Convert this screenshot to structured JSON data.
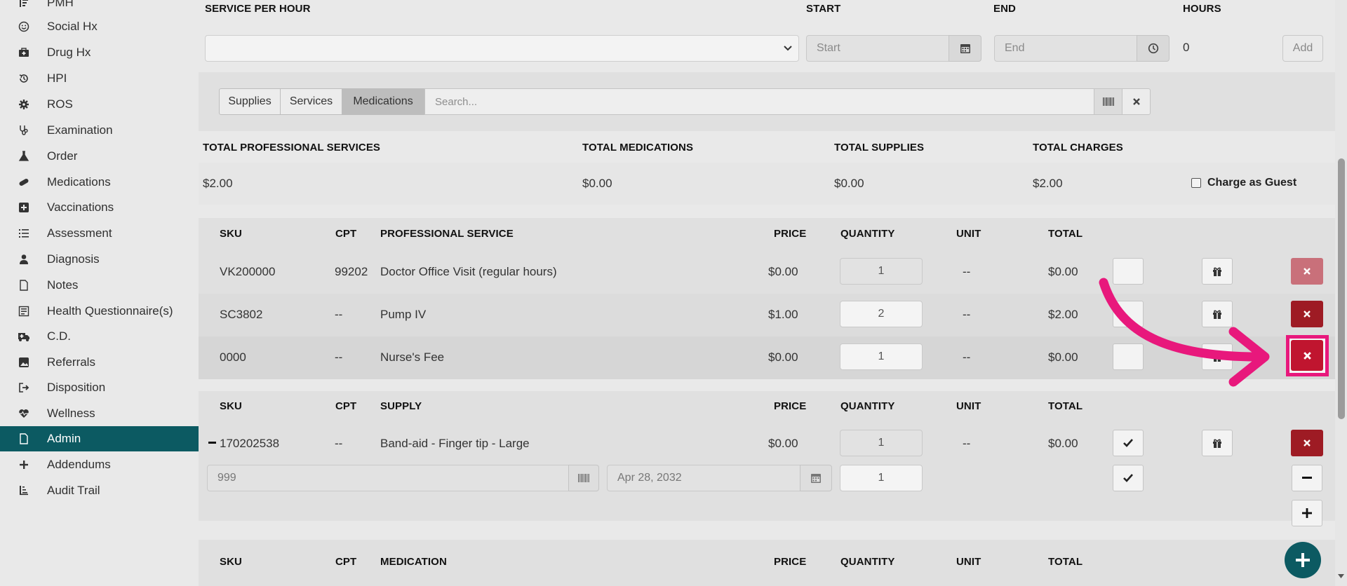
{
  "sidebar": {
    "items": [
      {
        "label": "PMH",
        "icon": "list-sort-icon"
      },
      {
        "label": "Social Hx",
        "icon": "smile-icon"
      },
      {
        "label": "Drug Hx",
        "icon": "medkit-icon"
      },
      {
        "label": "HPI",
        "icon": "history-icon"
      },
      {
        "label": "ROS",
        "icon": "gear-icon"
      },
      {
        "label": "Examination",
        "icon": "stethoscope-icon"
      },
      {
        "label": "Order",
        "icon": "flask-icon"
      },
      {
        "label": "Medications",
        "icon": "pill-icon"
      },
      {
        "label": "Vaccinations",
        "icon": "plus-square-icon"
      },
      {
        "label": "Assessment",
        "icon": "list-icon"
      },
      {
        "label": "Diagnosis",
        "icon": "user-doctor-icon"
      },
      {
        "label": "Notes",
        "icon": "file-icon"
      },
      {
        "label": "Health Questionnaire(s)",
        "icon": "form-icon"
      },
      {
        "label": "C.D.",
        "icon": "ambulance-icon"
      },
      {
        "label": "Referrals",
        "icon": "image-icon"
      },
      {
        "label": "Disposition",
        "icon": "sign-out-icon"
      },
      {
        "label": "Wellness",
        "icon": "heartbeat-icon"
      },
      {
        "label": "Admin",
        "icon": "file-icon"
      },
      {
        "label": "Addendums",
        "icon": "plus-icon"
      },
      {
        "label": "Audit Trail",
        "icon": "sort-amount-icon"
      }
    ],
    "active": "Admin"
  },
  "service_per_hour": {
    "headers": {
      "service": "SERVICE PER HOUR",
      "start": "START",
      "end": "END",
      "hours": "HOURS"
    },
    "start_placeholder": "Start",
    "end_placeholder": "End",
    "hours_value": "0",
    "add_label": "Add"
  },
  "search_tabs": {
    "tabs": [
      "Supplies",
      "Services",
      "Medications"
    ],
    "active": "Medications",
    "search_placeholder": "Search..."
  },
  "totals": {
    "headers": [
      "TOTAL PROFESSIONAL SERVICES",
      "TOTAL MEDICATIONS",
      "TOTAL SUPPLIES",
      "TOTAL CHARGES"
    ],
    "values": [
      "$2.00",
      "$0.00",
      "$0.00",
      "$2.00"
    ],
    "guest_label": "Charge as Guest"
  },
  "professional_services": {
    "headers": {
      "sku": "SKU",
      "cpt": "CPT",
      "name": "PROFESSIONAL SERVICE",
      "price": "PRICE",
      "quantity": "QUANTITY",
      "unit": "UNIT",
      "total": "TOTAL"
    },
    "rows": [
      {
        "sku": "VK200000",
        "cpt": "99202",
        "name": "Doctor Office Visit (regular hours)",
        "price": "$0.00",
        "quantity": "1",
        "unit": "--",
        "total": "$0.00"
      },
      {
        "sku": "SC3802",
        "cpt": "--",
        "name": "Pump IV",
        "price": "$1.00",
        "quantity": "2",
        "unit": "--",
        "total": "$2.00"
      },
      {
        "sku": "0000",
        "cpt": "--",
        "name": "Nurse's Fee",
        "price": "$0.00",
        "quantity": "1",
        "unit": "--",
        "total": "$0.00"
      }
    ]
  },
  "supplies": {
    "headers": {
      "sku": "SKU",
      "cpt": "CPT",
      "name": "SUPPLY",
      "price": "PRICE",
      "quantity": "QUANTITY",
      "unit": "UNIT",
      "total": "TOTAL"
    },
    "rows": [
      {
        "sku": "170202538",
        "cpt": "--",
        "name": "Band-aid - Finger tip - Large",
        "price": "$0.00",
        "quantity": "1",
        "unit": "--",
        "total": "$0.00"
      }
    ],
    "lot_value": "999",
    "expiry_value": "Apr 28, 2032",
    "lot_quantity": "1"
  },
  "medications": {
    "headers": {
      "sku": "SKU",
      "cpt": "CPT",
      "name": "MEDICATION",
      "price": "PRICE",
      "quantity": "QUANTITY",
      "unit": "UNIT",
      "total": "TOTAL"
    }
  },
  "colors": {
    "accent": "#0c5a62",
    "danger": "#9e1b24",
    "highlight": "#e8187c"
  }
}
